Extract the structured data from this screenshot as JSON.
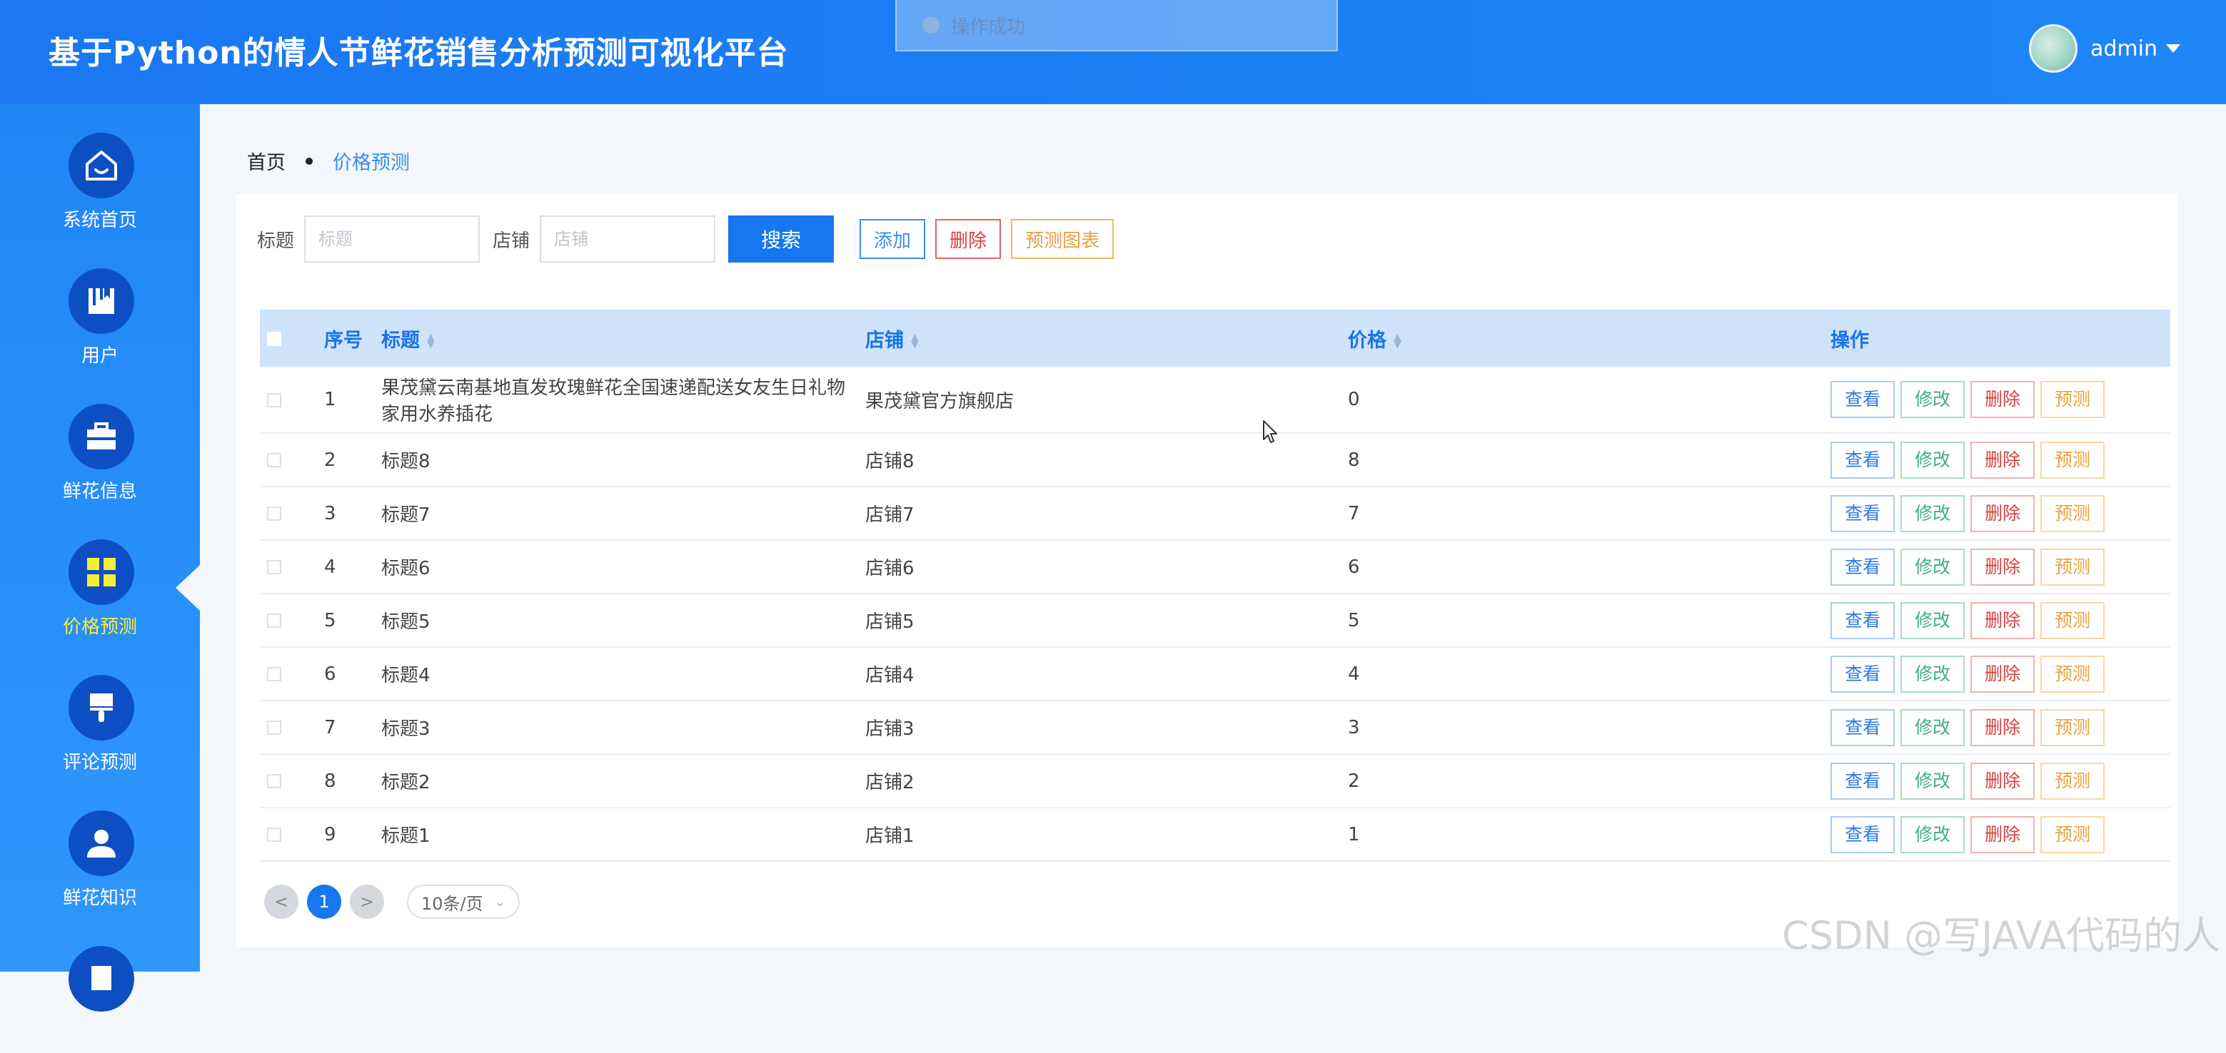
{
  "header": {
    "title": "基于Python的情人节鲜花销售分析预测可视化平台",
    "toast": "操作成功",
    "username": "admin"
  },
  "sidebar": {
    "items": [
      {
        "label": "系统首页",
        "icon": "home-icon"
      },
      {
        "label": "用户",
        "icon": "user-book-icon"
      },
      {
        "label": "鲜花信息",
        "icon": "briefcase-icon"
      },
      {
        "label": "价格预测",
        "icon": "grid-icon",
        "active": true
      },
      {
        "label": "评论预测",
        "icon": "brush-icon"
      },
      {
        "label": "鲜花知识",
        "icon": "person-icon"
      }
    ]
  },
  "breadcrumb": {
    "home": "首页",
    "current": "价格预测"
  },
  "search": {
    "title_label": "标题",
    "title_placeholder": "标题",
    "shop_label": "店铺",
    "shop_placeholder": "店铺",
    "search_btn": "搜索",
    "add_btn": "添加",
    "delete_btn": "删除",
    "chart_btn": "预测图表"
  },
  "table": {
    "columns": {
      "index": "序号",
      "title": "标题",
      "shop": "店铺",
      "price": "价格",
      "ops": "操作"
    },
    "ops": {
      "view": "查看",
      "edit": "修改",
      "delete": "删除",
      "predict": "预测"
    },
    "rows": [
      {
        "index": "1",
        "title": "果茂黛云南基地直发玫瑰鲜花全国速递配送女友生日礼物家用水养插花",
        "shop": "果茂黛官方旗舰店",
        "price": "0"
      },
      {
        "index": "2",
        "title": "标题8",
        "shop": "店铺8",
        "price": "8"
      },
      {
        "index": "3",
        "title": "标题7",
        "shop": "店铺7",
        "price": "7"
      },
      {
        "index": "4",
        "title": "标题6",
        "shop": "店铺6",
        "price": "6"
      },
      {
        "index": "5",
        "title": "标题5",
        "shop": "店铺5",
        "price": "5"
      },
      {
        "index": "6",
        "title": "标题4",
        "shop": "店铺4",
        "price": "4"
      },
      {
        "index": "7",
        "title": "标题3",
        "shop": "店铺3",
        "price": "3"
      },
      {
        "index": "8",
        "title": "标题2",
        "shop": "店铺2",
        "price": "2"
      },
      {
        "index": "9",
        "title": "标题1",
        "shop": "店铺1",
        "price": "1"
      }
    ]
  },
  "pager": {
    "prev": "<",
    "current": "1",
    "next": ">",
    "page_size": "10条/页"
  },
  "watermark": "CSDN @写JAVA代码的人",
  "colors": {
    "primary": "#1677f0",
    "header_bg": "#1a78f2",
    "sidebar_icon_bg": "#0d4fc2",
    "active_label": "#f8ed3a"
  }
}
